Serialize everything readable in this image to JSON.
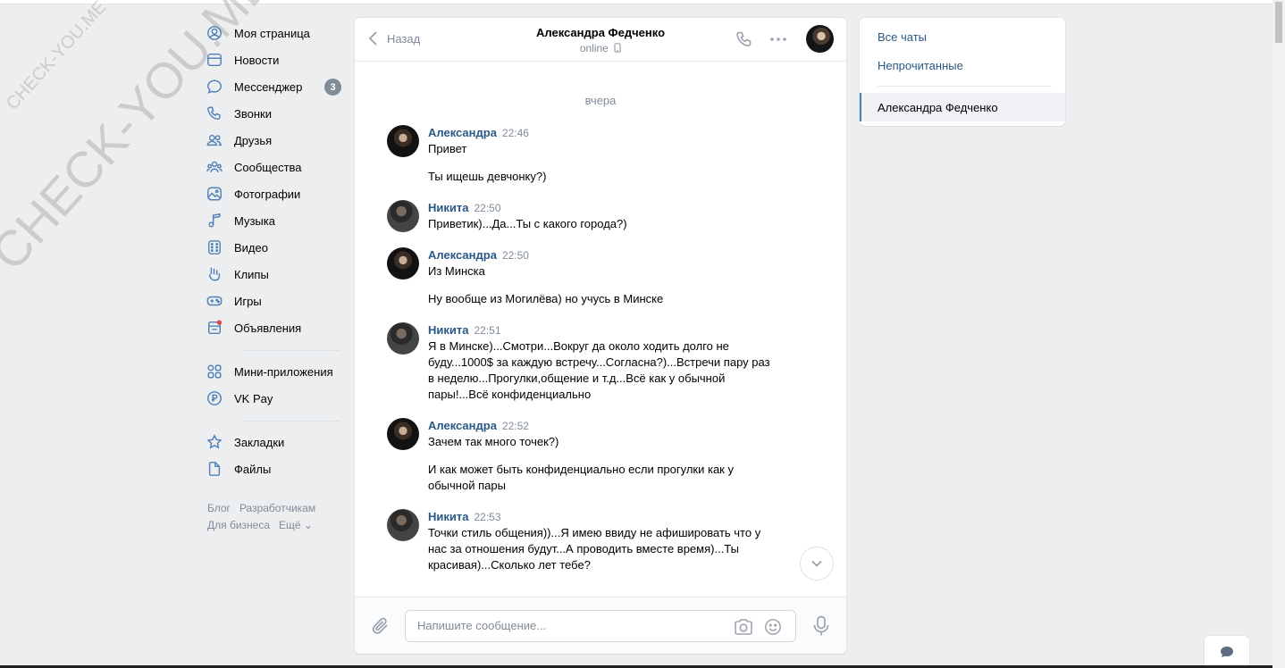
{
  "watermark": {
    "small": "CHECK-YOU.ME",
    "big": "CHECK-YOU.ME"
  },
  "nav": {
    "items": [
      {
        "label": "Моя страница",
        "icon": "user-circle-icon"
      },
      {
        "label": "Новости",
        "icon": "news-icon"
      },
      {
        "label": "Мессенджер",
        "icon": "message-icon",
        "badge": "3"
      },
      {
        "label": "Звонки",
        "icon": "phone-icon"
      },
      {
        "label": "Друзья",
        "icon": "friends-icon"
      },
      {
        "label": "Сообщества",
        "icon": "communities-icon"
      },
      {
        "label": "Фотографии",
        "icon": "photo-icon"
      },
      {
        "label": "Музыка",
        "icon": "music-icon"
      },
      {
        "label": "Видео",
        "icon": "video-icon"
      },
      {
        "label": "Клипы",
        "icon": "clips-icon"
      },
      {
        "label": "Игры",
        "icon": "gamepad-icon"
      },
      {
        "label": "Объявления",
        "icon": "ads-icon"
      }
    ],
    "items2": [
      {
        "label": "Мини-приложения",
        "icon": "apps-icon"
      },
      {
        "label": "VK Pay",
        "icon": "vkpay-icon"
      }
    ],
    "items3": [
      {
        "label": "Закладки",
        "icon": "star-icon"
      },
      {
        "label": "Файлы",
        "icon": "file-icon"
      }
    ],
    "footer": {
      "blog": "Блог",
      "developers": "Разработчикам",
      "business": "Для бизнеса",
      "more": "Ещё ⌄"
    }
  },
  "chat": {
    "back_label": "Назад",
    "peer_name": "Александра Федченко",
    "peer_status": "online",
    "day_label": "вчера",
    "messages": [
      {
        "author": "Александра",
        "time": "22:46",
        "side": "a",
        "texts": [
          "Привет",
          "Ты ищешь девчонку?)"
        ]
      },
      {
        "author": "Никита",
        "time": "22:50",
        "side": "n",
        "texts": [
          "Приветик)...Да...Ты с какого города?)"
        ]
      },
      {
        "author": "Александра",
        "time": "22:50",
        "side": "a",
        "texts": [
          "Из Минска",
          "Ну вообще из Могилёва) но учусь в Минске"
        ]
      },
      {
        "author": "Никита",
        "time": "22:51",
        "side": "n",
        "texts": [
          "Я в Минске)...Смотри...Вокруг да около ходить долго не буду...1000$ за каждую встречу...Согласна?)...Встречи пару раз в неделю...Прогулки,общение и т.д...Всё как у обычной пары!...Всё конфиденциально"
        ]
      },
      {
        "author": "Александра",
        "time": "22:52",
        "side": "a",
        "texts": [
          "Зачем так много точек?)",
          "И как может быть конфиденциально если прогулки как у обычной пары"
        ]
      },
      {
        "author": "Никита",
        "time": "22:53",
        "side": "n",
        "texts": [
          "Точки стиль общения))...Я имею ввиду не афишировать что у нас за отношения будут...А проводить вместе время)...Ты красивая)...Сколько лет тебе?"
        ]
      }
    ],
    "composer_placeholder": "Напишите сообщение..."
  },
  "right_panel": {
    "all_chats": "Все чаты",
    "unread": "Непрочитанные",
    "active_chat": "Александра Федченко"
  },
  "colors": {
    "background": "#edeef0",
    "link": "#2a5885",
    "secondary": "#818c99",
    "accent": "#5181b8"
  }
}
